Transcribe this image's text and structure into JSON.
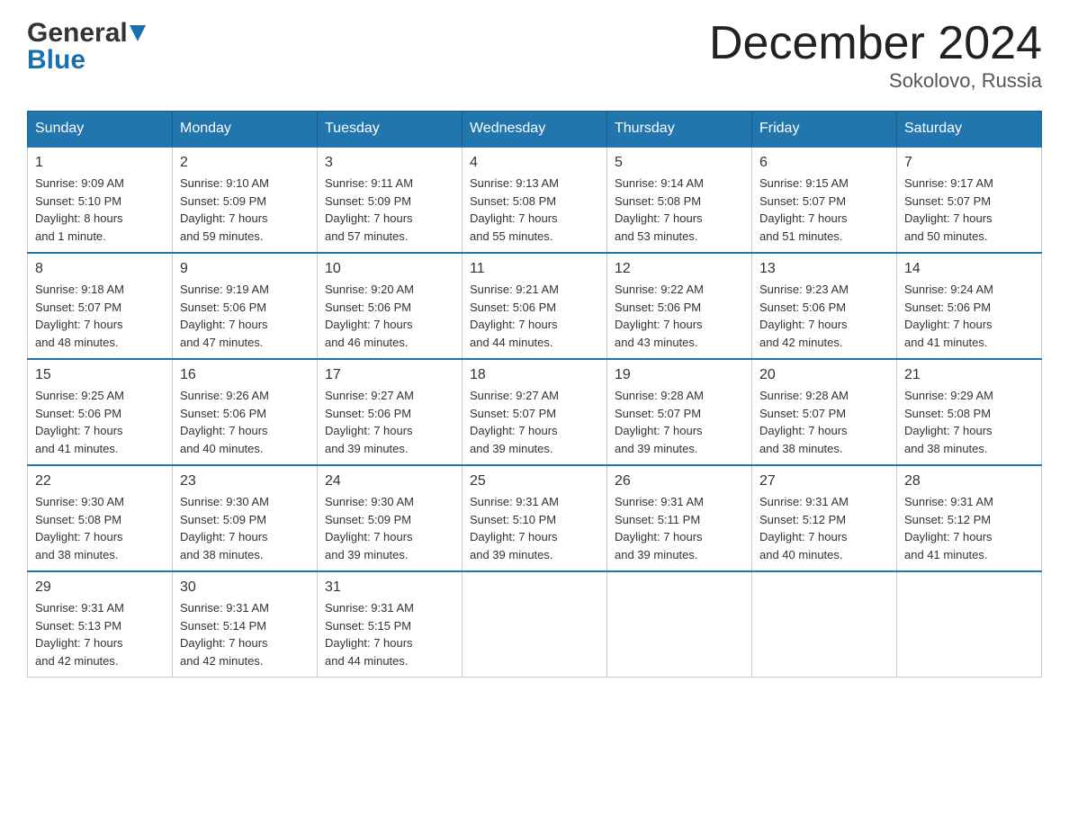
{
  "header": {
    "title": "December 2024",
    "subtitle": "Sokolovo, Russia",
    "logo_general": "General",
    "logo_blue": "Blue"
  },
  "days_of_week": [
    "Sunday",
    "Monday",
    "Tuesday",
    "Wednesday",
    "Thursday",
    "Friday",
    "Saturday"
  ],
  "weeks": [
    [
      {
        "day": "1",
        "sunrise": "Sunrise: 9:09 AM",
        "sunset": "Sunset: 5:10 PM",
        "daylight": "Daylight: 8 hours",
        "daylight2": "and 1 minute."
      },
      {
        "day": "2",
        "sunrise": "Sunrise: 9:10 AM",
        "sunset": "Sunset: 5:09 PM",
        "daylight": "Daylight: 7 hours",
        "daylight2": "and 59 minutes."
      },
      {
        "day": "3",
        "sunrise": "Sunrise: 9:11 AM",
        "sunset": "Sunset: 5:09 PM",
        "daylight": "Daylight: 7 hours",
        "daylight2": "and 57 minutes."
      },
      {
        "day": "4",
        "sunrise": "Sunrise: 9:13 AM",
        "sunset": "Sunset: 5:08 PM",
        "daylight": "Daylight: 7 hours",
        "daylight2": "and 55 minutes."
      },
      {
        "day": "5",
        "sunrise": "Sunrise: 9:14 AM",
        "sunset": "Sunset: 5:08 PM",
        "daylight": "Daylight: 7 hours",
        "daylight2": "and 53 minutes."
      },
      {
        "day": "6",
        "sunrise": "Sunrise: 9:15 AM",
        "sunset": "Sunset: 5:07 PM",
        "daylight": "Daylight: 7 hours",
        "daylight2": "and 51 minutes."
      },
      {
        "day": "7",
        "sunrise": "Sunrise: 9:17 AM",
        "sunset": "Sunset: 5:07 PM",
        "daylight": "Daylight: 7 hours",
        "daylight2": "and 50 minutes."
      }
    ],
    [
      {
        "day": "8",
        "sunrise": "Sunrise: 9:18 AM",
        "sunset": "Sunset: 5:07 PM",
        "daylight": "Daylight: 7 hours",
        "daylight2": "and 48 minutes."
      },
      {
        "day": "9",
        "sunrise": "Sunrise: 9:19 AM",
        "sunset": "Sunset: 5:06 PM",
        "daylight": "Daylight: 7 hours",
        "daylight2": "and 47 minutes."
      },
      {
        "day": "10",
        "sunrise": "Sunrise: 9:20 AM",
        "sunset": "Sunset: 5:06 PM",
        "daylight": "Daylight: 7 hours",
        "daylight2": "and 46 minutes."
      },
      {
        "day": "11",
        "sunrise": "Sunrise: 9:21 AM",
        "sunset": "Sunset: 5:06 PM",
        "daylight": "Daylight: 7 hours",
        "daylight2": "and 44 minutes."
      },
      {
        "day": "12",
        "sunrise": "Sunrise: 9:22 AM",
        "sunset": "Sunset: 5:06 PM",
        "daylight": "Daylight: 7 hours",
        "daylight2": "and 43 minutes."
      },
      {
        "day": "13",
        "sunrise": "Sunrise: 9:23 AM",
        "sunset": "Sunset: 5:06 PM",
        "daylight": "Daylight: 7 hours",
        "daylight2": "and 42 minutes."
      },
      {
        "day": "14",
        "sunrise": "Sunrise: 9:24 AM",
        "sunset": "Sunset: 5:06 PM",
        "daylight": "Daylight: 7 hours",
        "daylight2": "and 41 minutes."
      }
    ],
    [
      {
        "day": "15",
        "sunrise": "Sunrise: 9:25 AM",
        "sunset": "Sunset: 5:06 PM",
        "daylight": "Daylight: 7 hours",
        "daylight2": "and 41 minutes."
      },
      {
        "day": "16",
        "sunrise": "Sunrise: 9:26 AM",
        "sunset": "Sunset: 5:06 PM",
        "daylight": "Daylight: 7 hours",
        "daylight2": "and 40 minutes."
      },
      {
        "day": "17",
        "sunrise": "Sunrise: 9:27 AM",
        "sunset": "Sunset: 5:06 PM",
        "daylight": "Daylight: 7 hours",
        "daylight2": "and 39 minutes."
      },
      {
        "day": "18",
        "sunrise": "Sunrise: 9:27 AM",
        "sunset": "Sunset: 5:07 PM",
        "daylight": "Daylight: 7 hours",
        "daylight2": "and 39 minutes."
      },
      {
        "day": "19",
        "sunrise": "Sunrise: 9:28 AM",
        "sunset": "Sunset: 5:07 PM",
        "daylight": "Daylight: 7 hours",
        "daylight2": "and 39 minutes."
      },
      {
        "day": "20",
        "sunrise": "Sunrise: 9:28 AM",
        "sunset": "Sunset: 5:07 PM",
        "daylight": "Daylight: 7 hours",
        "daylight2": "and 38 minutes."
      },
      {
        "day": "21",
        "sunrise": "Sunrise: 9:29 AM",
        "sunset": "Sunset: 5:08 PM",
        "daylight": "Daylight: 7 hours",
        "daylight2": "and 38 minutes."
      }
    ],
    [
      {
        "day": "22",
        "sunrise": "Sunrise: 9:30 AM",
        "sunset": "Sunset: 5:08 PM",
        "daylight": "Daylight: 7 hours",
        "daylight2": "and 38 minutes."
      },
      {
        "day": "23",
        "sunrise": "Sunrise: 9:30 AM",
        "sunset": "Sunset: 5:09 PM",
        "daylight": "Daylight: 7 hours",
        "daylight2": "and 38 minutes."
      },
      {
        "day": "24",
        "sunrise": "Sunrise: 9:30 AM",
        "sunset": "Sunset: 5:09 PM",
        "daylight": "Daylight: 7 hours",
        "daylight2": "and 39 minutes."
      },
      {
        "day": "25",
        "sunrise": "Sunrise: 9:31 AM",
        "sunset": "Sunset: 5:10 PM",
        "daylight": "Daylight: 7 hours",
        "daylight2": "and 39 minutes."
      },
      {
        "day": "26",
        "sunrise": "Sunrise: 9:31 AM",
        "sunset": "Sunset: 5:11 PM",
        "daylight": "Daylight: 7 hours",
        "daylight2": "and 39 minutes."
      },
      {
        "day": "27",
        "sunrise": "Sunrise: 9:31 AM",
        "sunset": "Sunset: 5:12 PM",
        "daylight": "Daylight: 7 hours",
        "daylight2": "and 40 minutes."
      },
      {
        "day": "28",
        "sunrise": "Sunrise: 9:31 AM",
        "sunset": "Sunset: 5:12 PM",
        "daylight": "Daylight: 7 hours",
        "daylight2": "and 41 minutes."
      }
    ],
    [
      {
        "day": "29",
        "sunrise": "Sunrise: 9:31 AM",
        "sunset": "Sunset: 5:13 PM",
        "daylight": "Daylight: 7 hours",
        "daylight2": "and 42 minutes."
      },
      {
        "day": "30",
        "sunrise": "Sunrise: 9:31 AM",
        "sunset": "Sunset: 5:14 PM",
        "daylight": "Daylight: 7 hours",
        "daylight2": "and 42 minutes."
      },
      {
        "day": "31",
        "sunrise": "Sunrise: 9:31 AM",
        "sunset": "Sunset: 5:15 PM",
        "daylight": "Daylight: 7 hours",
        "daylight2": "and 44 minutes."
      },
      null,
      null,
      null,
      null
    ]
  ]
}
